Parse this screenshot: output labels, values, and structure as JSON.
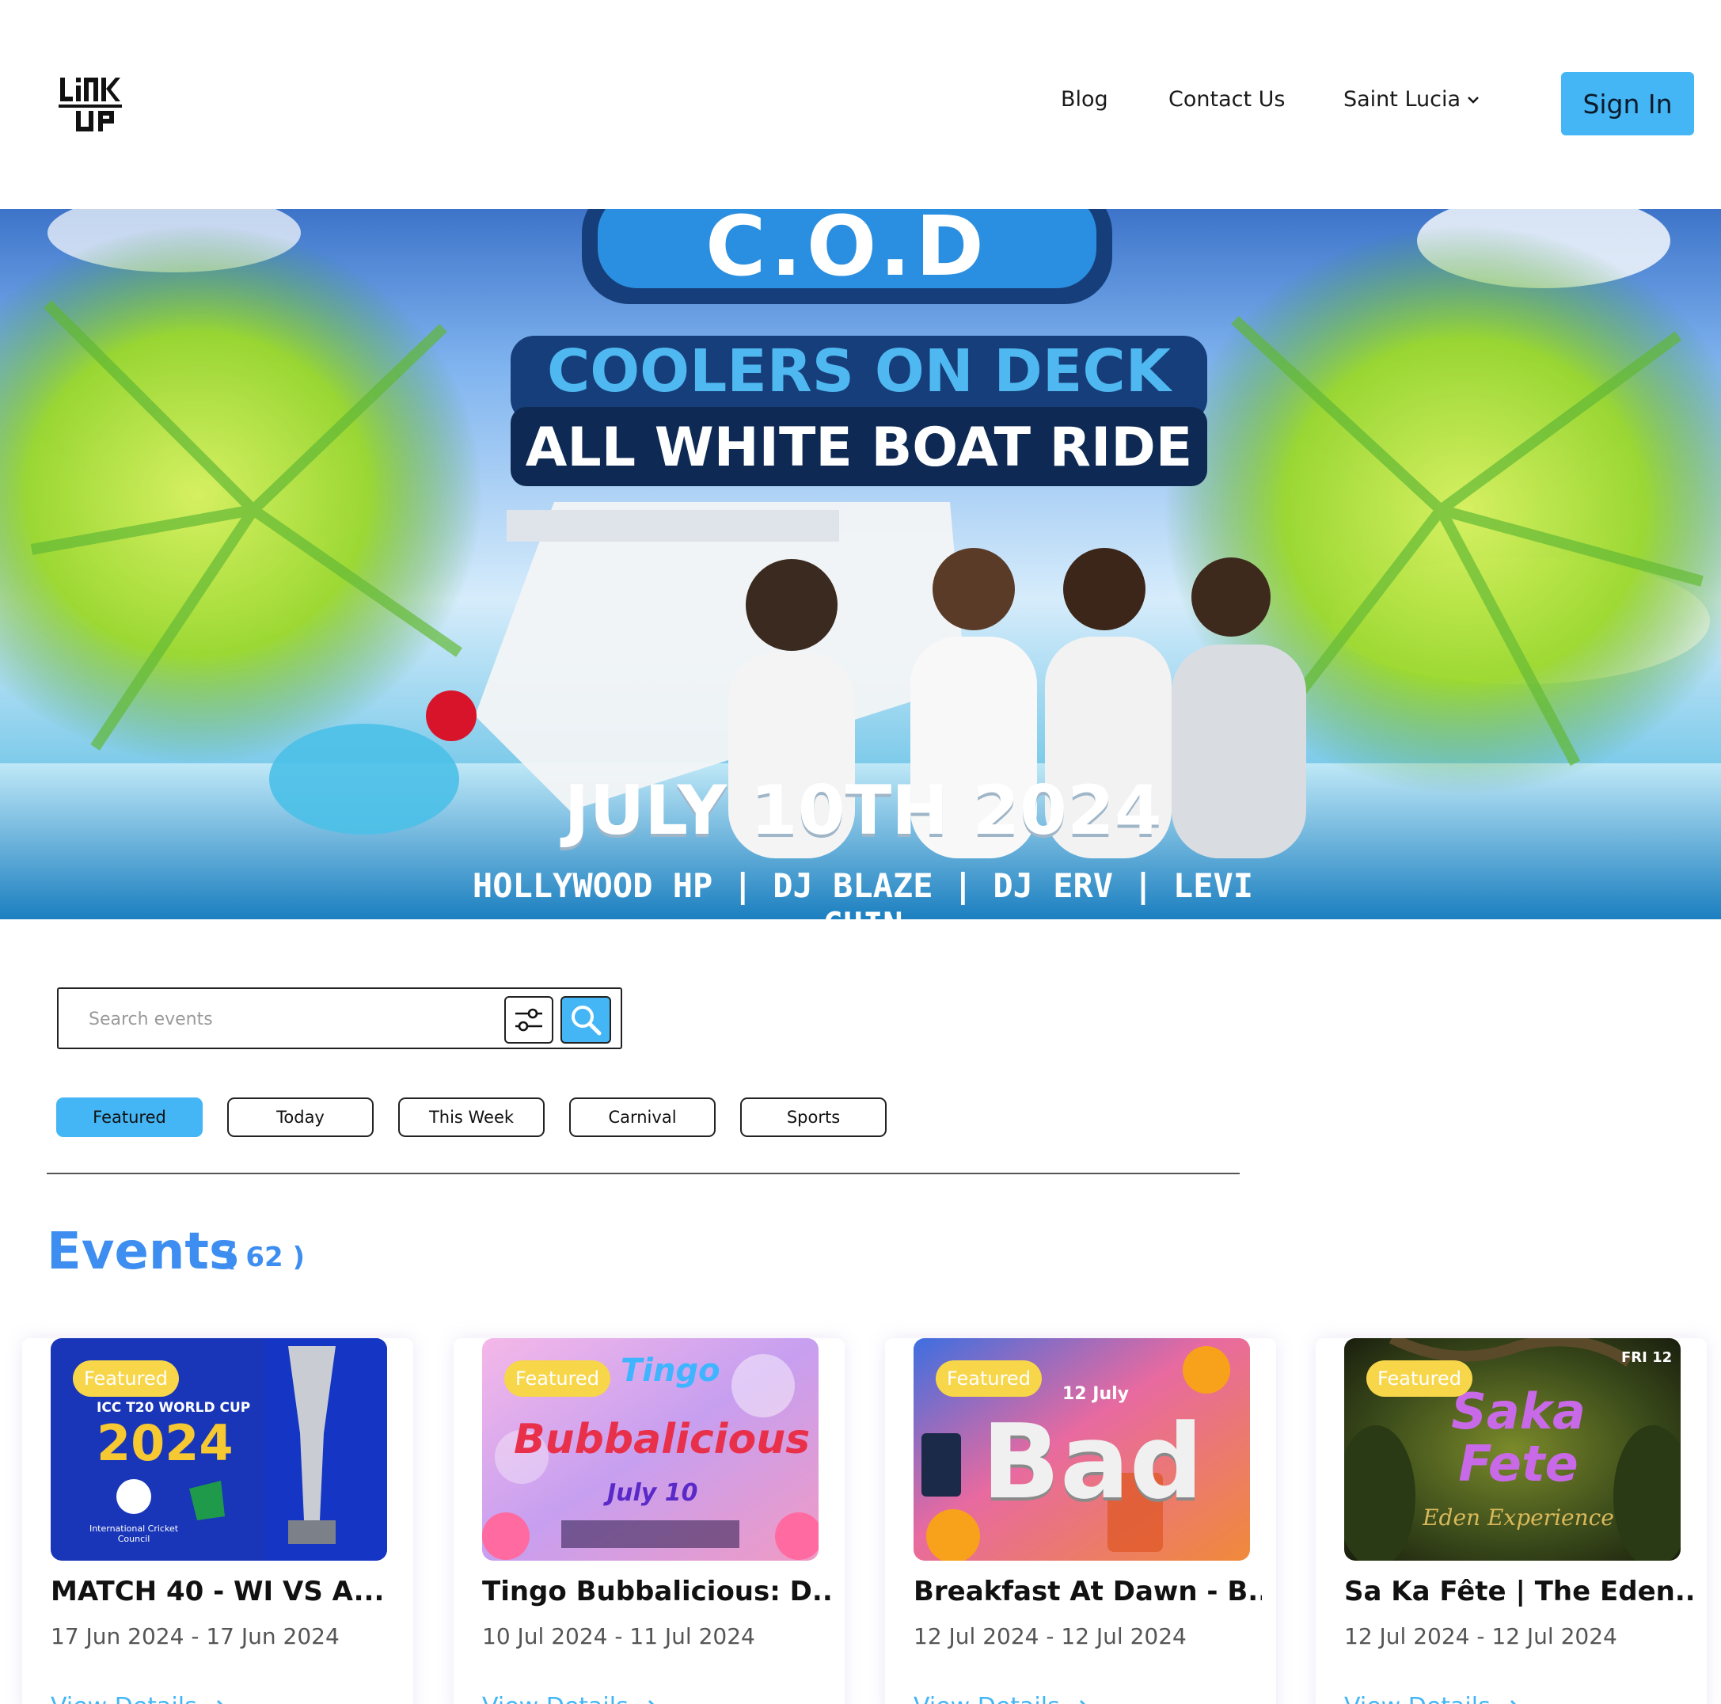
{
  "header": {
    "logo_alt": "LINK UP",
    "nav": {
      "blog": "Blog",
      "contact": "Contact Us",
      "region": "Saint Lucia"
    },
    "sign_in": "Sign In"
  },
  "hero": {
    "logo_text": "C.O.D",
    "title": "COOLERS ON DECK",
    "subtitle": "ALL WHITE BOAT RIDE",
    "date": "JULY 10TH 2024",
    "lineup": "HOLLYWOOD HP | DJ BLAZE | DJ ERV | LEVI CHIN"
  },
  "search": {
    "placeholder": "Search events"
  },
  "tabs": [
    {
      "label": "Featured",
      "active": true
    },
    {
      "label": "Today",
      "active": false
    },
    {
      "label": "This Week",
      "active": false
    },
    {
      "label": "Carnival",
      "active": false
    },
    {
      "label": "Sports",
      "active": false
    }
  ],
  "events": {
    "heading": "Events",
    "count": "( 62 )",
    "cards": [
      {
        "badge": "Featured",
        "title": "MATCH 40 - WI VS A...",
        "date": "17 Jun 2024 - 17 Jun 2024",
        "link": "View Details",
        "poster_text": {
          "line1": "ICC T20 WORLD CUP",
          "line2": "2024",
          "line3": "International Cricket Council"
        }
      },
      {
        "badge": "Featured",
        "title": "Tingo Bubbalicious: D...",
        "date": "10 Jul 2024 - 11 Jul 2024",
        "link": "View Details",
        "poster_text": {
          "line1": "Tingo",
          "line2": "Bubbalicious",
          "line3": "July 10"
        }
      },
      {
        "badge": "Featured",
        "title": "Breakfast At Dawn - B...",
        "date": "12 Jul 2024 - 12 Jul 2024",
        "link": "View Details",
        "poster_text": {
          "line1": "12 July",
          "line2": "Bad",
          "line3": ""
        }
      },
      {
        "badge": "Featured",
        "title": "Sa Ka Fête | The Eden...",
        "date": "12 Jul 2024 - 12 Jul 2024",
        "link": "View Details",
        "poster_text": {
          "line1": "FRI 12",
          "line2": "Saka Fete",
          "line3": "Eden Experience"
        }
      }
    ]
  },
  "colors": {
    "accent": "#44b6f5",
    "heading": "#3d8ef0",
    "badge": "#f7d64a"
  }
}
